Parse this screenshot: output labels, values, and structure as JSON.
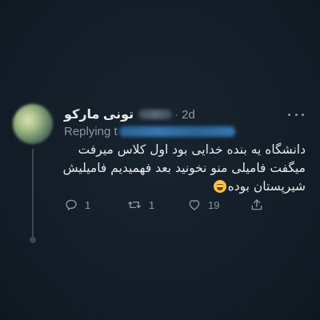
{
  "tweet": {
    "display_name": "تونی مارکو",
    "separator": "·",
    "time": "2d",
    "replying_prefix": "Replying t",
    "text_lines": [
      "دانشگاه یه بنده خدایی بود اول کلاس میرفت",
      "میگفت فامیلی منو نخونید بعد فهمیدیم فامیلیش",
      "شیرپستان بوده"
    ],
    "emoji": "laughing-face-emoji"
  },
  "actions": {
    "reply_count": "1",
    "retweet_count": "1",
    "like_count": "19"
  },
  "colors": {
    "background": "#15202b",
    "text": "#e7e9ea",
    "secondary": "#8b98a5"
  }
}
